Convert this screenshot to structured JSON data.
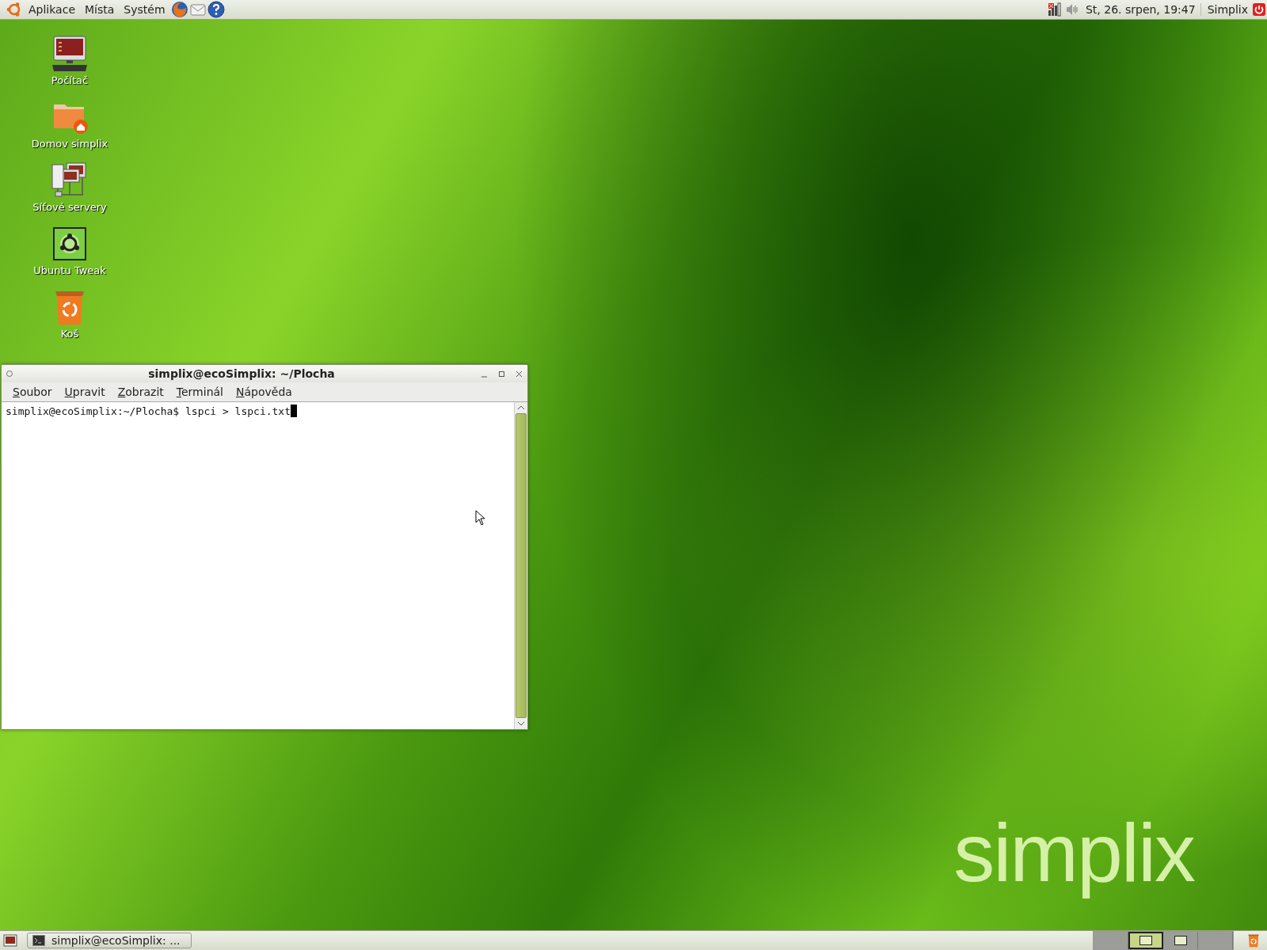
{
  "top_panel": {
    "menus": [
      {
        "label": "Aplikace"
      },
      {
        "label": "Místa"
      },
      {
        "label": "Systém"
      }
    ],
    "launchers": [
      {
        "kind": "browser"
      },
      {
        "kind": "mail"
      },
      {
        "kind": "help"
      }
    ],
    "clock": "St, 26. srpen, 19:47",
    "user": "Simplix"
  },
  "desktop": {
    "icons": [
      {
        "label": "Počítač",
        "kind": "computer"
      },
      {
        "label": "Domov simplix",
        "kind": "home"
      },
      {
        "label": "Síťové servery",
        "kind": "network"
      },
      {
        "label": "Ubuntu Tweak",
        "kind": "tweak"
      },
      {
        "label": "Koš",
        "kind": "trash"
      }
    ],
    "logo_text": "simplix"
  },
  "window": {
    "title": "simplix@ecoSimplix: ~/Plocha",
    "menus": [
      {
        "mnemonic": "S",
        "rest": "oubor"
      },
      {
        "mnemonic": "U",
        "rest": "pravit"
      },
      {
        "mnemonic": "Z",
        "rest": "obrazit"
      },
      {
        "mnemonic": "T",
        "rest": "erminál"
      },
      {
        "mnemonic": "N",
        "rest": "ápověda"
      }
    ],
    "prompt": "simplix@ecoSimplix:~/Plocha$ lspci > lspci.txt"
  },
  "bottom_panel": {
    "tasks": [
      {
        "label": "simplix@ecoSimplix: ...",
        "selected": false
      }
    ],
    "workspaces": [
      {
        "selected": false,
        "has_window": false
      },
      {
        "selected": true,
        "has_window": true
      },
      {
        "selected": false,
        "has_window": true
      },
      {
        "selected": false,
        "has_window": false
      }
    ]
  }
}
